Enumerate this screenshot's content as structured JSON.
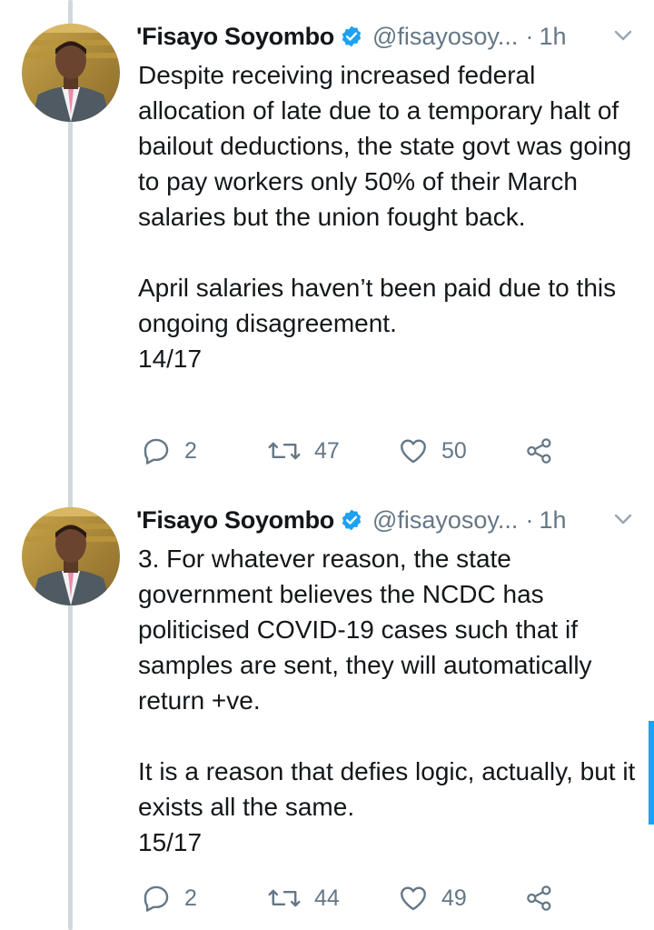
{
  "tweets": [
    {
      "author_name": "'Fisayo Soyombo",
      "handle": "@fisayosoy...",
      "separator": "·",
      "time": "1h",
      "paragraphs": [
        "Despite receiving increased federal allocation of late due to a temporary halt of bailout deductions, the state govt was going to pay workers only 50% of their March salaries but the union fought back.",
        "April salaries haven’t been paid due to this ongoing disagreement.",
        "14/17"
      ],
      "replies": "2",
      "retweets": "47",
      "likes": "50"
    },
    {
      "author_name": "'Fisayo Soyombo",
      "handle": "@fisayosoy...",
      "separator": "·",
      "time": "1h",
      "paragraphs": [
        "3. For whatever reason, the state government believes the NCDC has politicised COVID-19 cases such that if samples are sent, they will automatically return +ve.",
        "It is a reason that defies logic, actually, but it exists all the same.",
        "15/17"
      ],
      "replies": "2",
      "retweets": "44",
      "likes": "49"
    }
  ],
  "icons": {
    "verified": "verified-badge-icon",
    "caret": "chevron-down-icon",
    "reply": "reply-icon",
    "retweet": "retweet-icon",
    "like": "heart-icon",
    "share": "share-icon"
  },
  "colors": {
    "text": "#14171a",
    "muted": "#657786",
    "verified": "#1da1f2",
    "thread_line": "#cfd9de",
    "scrollbar": "#1da1f2"
  }
}
